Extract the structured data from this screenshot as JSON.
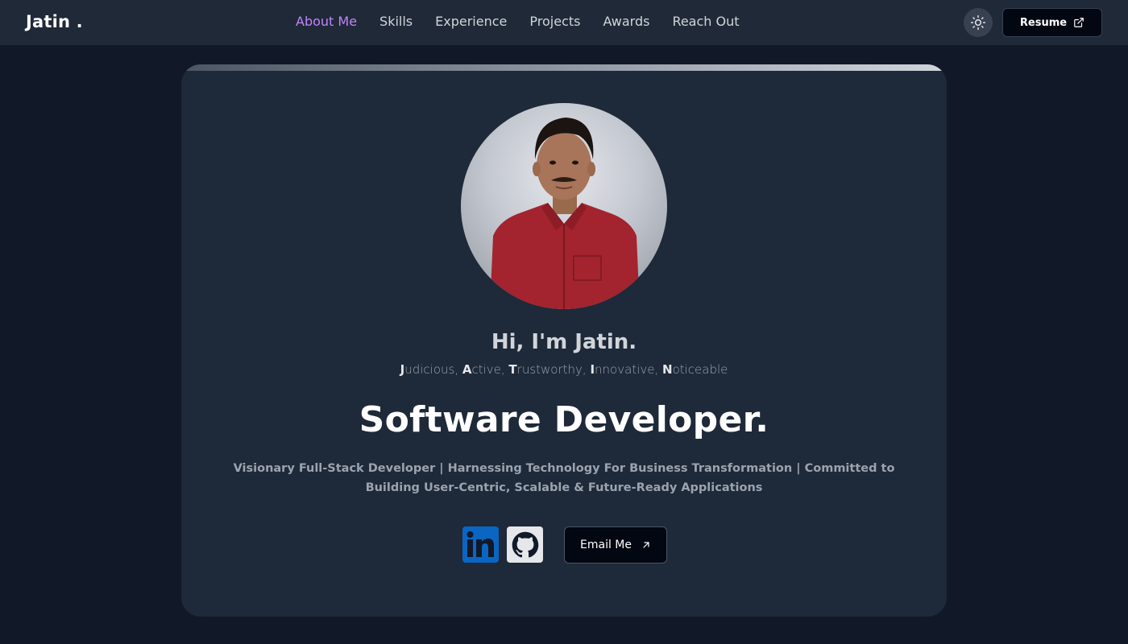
{
  "brand": {
    "name": "Jatin ."
  },
  "nav": {
    "items": [
      {
        "label": "About Me",
        "active": true
      },
      {
        "label": "Skills",
        "active": false
      },
      {
        "label": "Experience",
        "active": false
      },
      {
        "label": "Projects",
        "active": false
      },
      {
        "label": "Awards",
        "active": false
      },
      {
        "label": "Reach Out",
        "active": false
      }
    ],
    "theme_toggle_icon": "sun-icon",
    "resume_label": "Resume",
    "resume_icon": "external-link-icon"
  },
  "hero": {
    "greeting": "Hi, I'm Jatin.",
    "traits": [
      {
        "initial": "J",
        "rest": "udicious"
      },
      {
        "initial": "A",
        "rest": "ctive"
      },
      {
        "initial": "T",
        "rest": "rustworthy"
      },
      {
        "initial": "I",
        "rest": "nnovative"
      },
      {
        "initial": "N",
        "rest": "oticeable"
      }
    ],
    "role": "Software Developer.",
    "tagline": "Visionary Full-Stack Developer | Harnessing Technology For Business Transformation | Committed to Building User-Centric, Scalable & Future-Ready Applications",
    "socials": [
      {
        "icon": "linkedin-icon"
      },
      {
        "icon": "github-icon"
      }
    ],
    "email_label": "Email Me",
    "email_icon": "arrow-up-right-icon"
  },
  "colors": {
    "background": "#111827",
    "navbar": "#1f2937",
    "card": "#1e2939",
    "accent": "#c084fc",
    "linkedin": "#0a66c2"
  }
}
